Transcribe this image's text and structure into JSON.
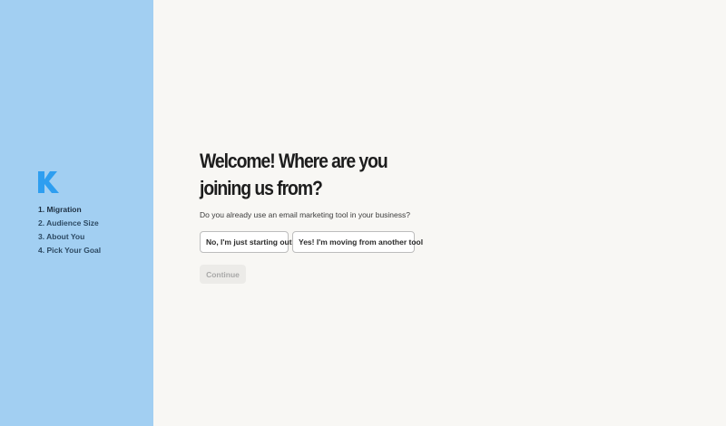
{
  "brand": {
    "logo_icon": "klaviyo-k-logo-icon",
    "logo_color": "#2e9ef0"
  },
  "sidebar": {
    "background": "#a2cff2",
    "steps": [
      {
        "label": "1. Migration"
      },
      {
        "label": "2. Audience Size"
      },
      {
        "label": "3. About You"
      },
      {
        "label": "4. Pick Your Goal"
      }
    ]
  },
  "main": {
    "title": "Welcome! Where are you joining us from?",
    "subtitle": "Do you already use an email marketing tool in your business?",
    "options": [
      {
        "label": "No, I'm just starting out"
      },
      {
        "label": "Yes! I'm moving from another tool"
      }
    ],
    "continue_label": "Continue"
  }
}
